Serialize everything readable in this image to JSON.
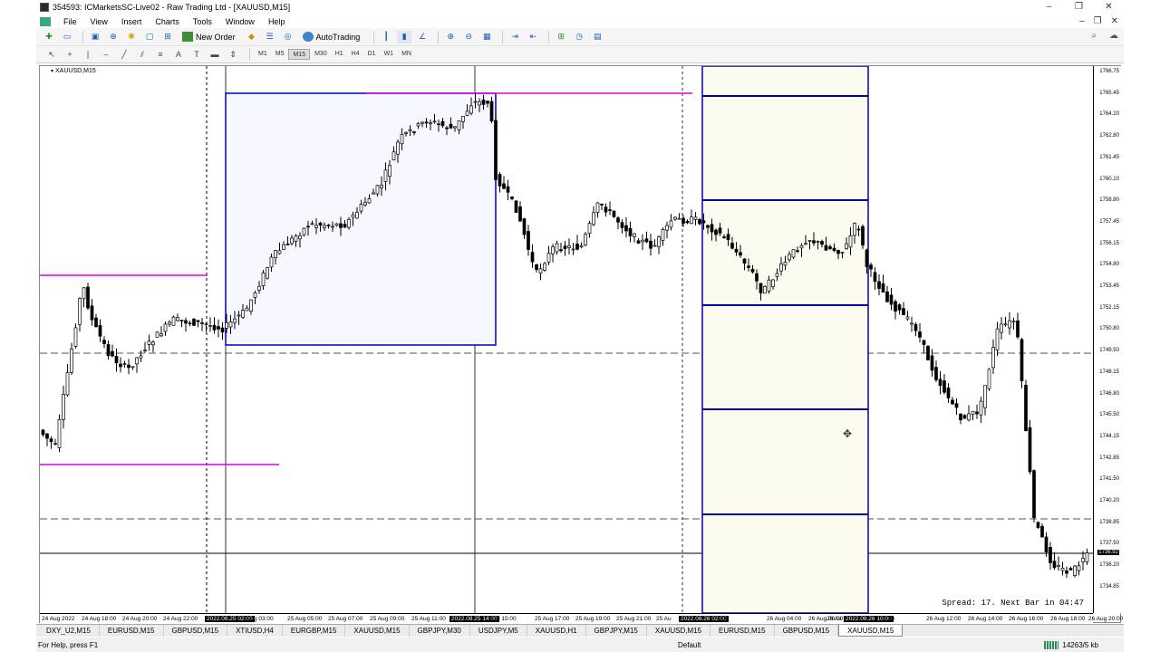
{
  "window": {
    "title": "354593: ICMarketsSC-Live02 - Raw Trading Ltd - [XAUUSD,M15]",
    "controls": [
      "–",
      "❐",
      "✕"
    ]
  },
  "menu": {
    "items": [
      "File",
      "View",
      "Insert",
      "Charts",
      "Tools",
      "Window",
      "Help"
    ]
  },
  "toolbar": {
    "new_order_label": "New Order",
    "autotrading_label": "AutoTrading"
  },
  "timeframes": [
    "M1",
    "M5",
    "M15",
    "M30",
    "H1",
    "H4",
    "D1",
    "W1",
    "MN"
  ],
  "active_timeframe": "M15",
  "chart": {
    "symbol_label": "XAUUSD,M15",
    "spread_text": "Spread: 17. Next Bar in 04:47",
    "price_levels": [
      "1765.45",
      "1764.10",
      "1762.80",
      "1761.45",
      "1760.10",
      "1758.80",
      "1757.45",
      "1756.15",
      "1754.80",
      "1753.45",
      "1752.15",
      "1750.80",
      "1749.50",
      "1748.15",
      "1746.80",
      "1745.50",
      "1744.15",
      "1742.85",
      "1741.50",
      "1740.20",
      "1738.85",
      "1737.50",
      "1736.20",
      "1734.85"
    ],
    "top_price": "1766.75",
    "bottom_price": "1733.50",
    "current_price": "1736.92",
    "time_labels": [
      {
        "text": "24 Aug 2022",
        "hl": false
      },
      {
        "text": "24 Aug 18:00",
        "hl": false
      },
      {
        "text": "24 Aug 20:00",
        "hl": false
      },
      {
        "text": "24 Aug 22:00",
        "hl": false
      },
      {
        "text": "2022.08.25 02:00",
        "hl": true
      },
      {
        "text": "Aug 03:00",
        "hl": false
      },
      {
        "text": "25 Aug 05:00",
        "hl": false
      },
      {
        "text": "25 Aug 07:00",
        "hl": false
      },
      {
        "text": "25 Aug 09:00",
        "hl": false
      },
      {
        "text": "25 Aug 11:00",
        "hl": false
      },
      {
        "text": "2022.08.25 14:00",
        "hl": true
      },
      {
        "text": "Aug 15:00",
        "hl": false
      },
      {
        "text": "25 Aug 17:00",
        "hl": false
      },
      {
        "text": "25 Aug 19:00",
        "hl": false
      },
      {
        "text": "25 Aug 21:00",
        "hl": false
      },
      {
        "text": "25 Au",
        "hl": false
      },
      {
        "text": "2022.08.26 02:00",
        "hl": true
      },
      {
        "text": ":00",
        "hl": false
      },
      {
        "text": "26 Aug 04:00",
        "hl": false
      },
      {
        "text": "26 Aug 06:00",
        "hl": false
      },
      {
        "text": "26 Au",
        "hl": false
      },
      {
        "text": "2022.08.26 10:00",
        "hl": true
      },
      {
        "text": ":00",
        "hl": false
      },
      {
        "text": "26 Aug 12:00",
        "hl": false
      },
      {
        "text": "26 Aug 14:00",
        "hl": false
      },
      {
        "text": "26 Aug 16:00",
        "hl": false
      },
      {
        "text": "26 Aug 18:00",
        "hl": false
      },
      {
        "text": "26 Aug 20:00",
        "hl": false
      }
    ]
  },
  "tabs": [
    "DXY_U2,M15",
    "EURUSD,M15",
    "GBPUSD,M15",
    "XTIUSD,H4",
    "EURGBP,M15",
    "XAUUSD,M15",
    "GBPJPY,M30",
    "USDJPY,M5",
    "XAUUSD,H1",
    "GBPJPY,M15",
    "XAUUSD,M15",
    "EURUSD,M15",
    "GBPUSD,M15",
    "XAUUSD,M15"
  ],
  "active_tab_index": 13,
  "status": {
    "help": "For Help, press F1",
    "profile": "Default",
    "connection": "14263/5 kb"
  },
  "colors": {
    "candle_bull": "#ffffff",
    "candle_bear": "#000000",
    "box_blue": "#0000b0",
    "magenta": "#e000e0"
  }
}
